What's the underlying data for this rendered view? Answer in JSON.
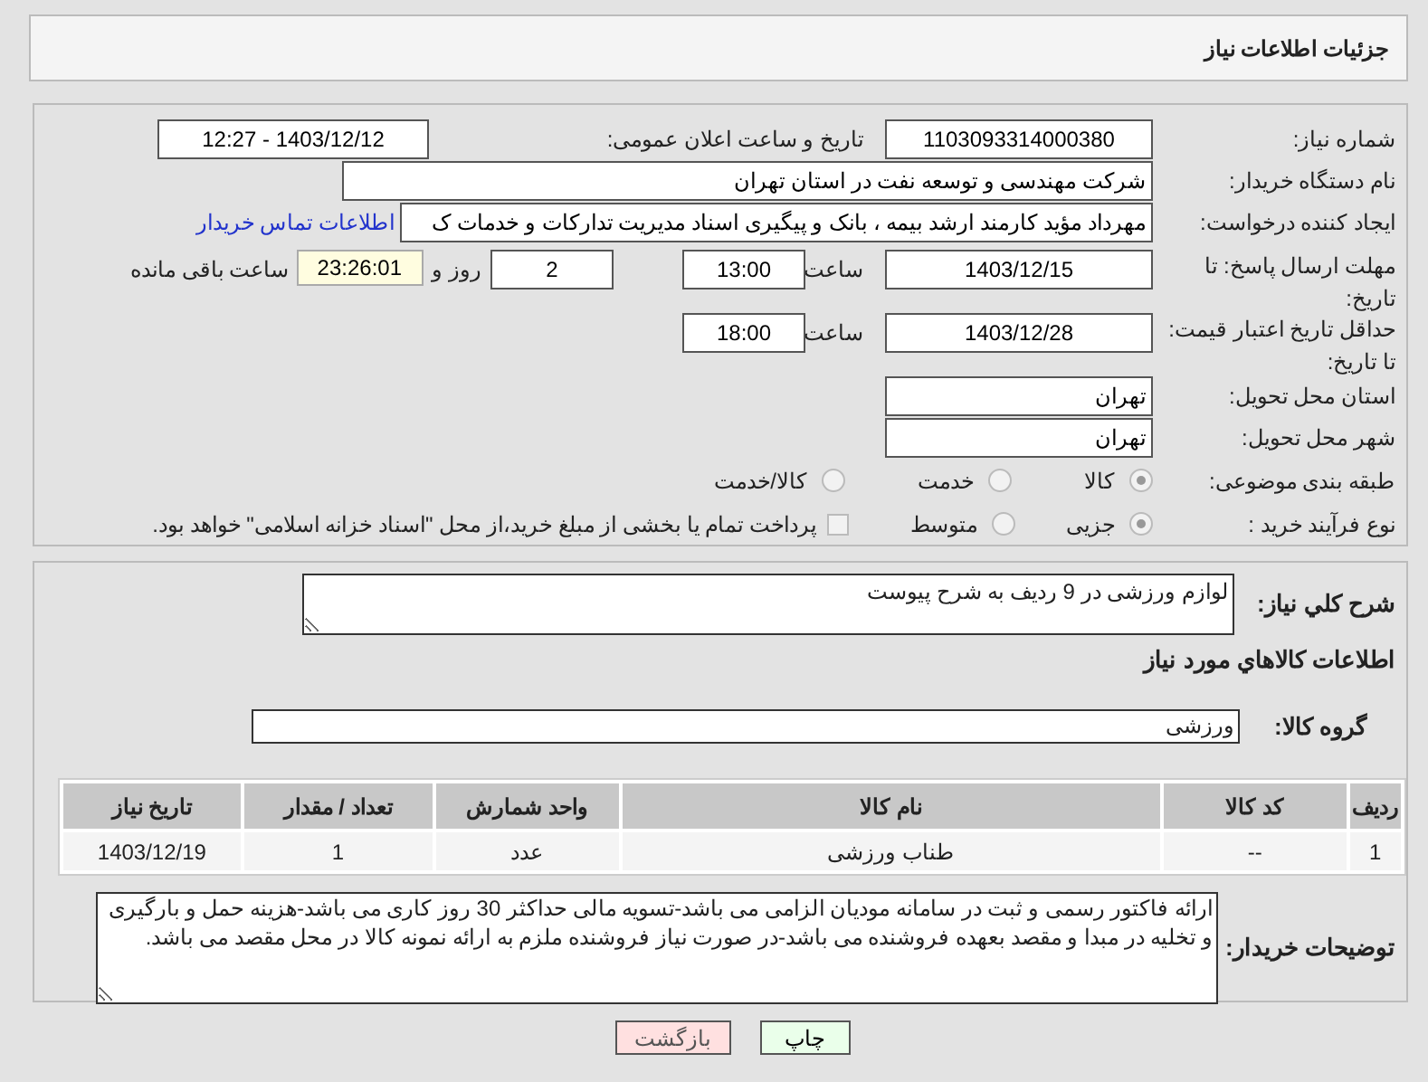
{
  "header": {
    "title": "جزئیات اطلاعات نیاز"
  },
  "need_number": {
    "label": "شماره نیاز:",
    "value": "1103093314000380"
  },
  "announce": {
    "label": "تاریخ و ساعت اعلان عمومی:",
    "value": "1403/12/12 - 12:27"
  },
  "buyer": {
    "label": "نام دستگاه خریدار:",
    "value": "شرکت مهندسی و توسعه نفت در استان تهران"
  },
  "creator": {
    "label": "ایجاد کننده درخواست:",
    "value": "مهرداد مؤید کارمند ارشد بیمه ، بانک و پیگیری اسناد مدیریت تدارکات و خدمات ک",
    "link": "اطلاعات تماس خریدار"
  },
  "deadline": {
    "label": "مهلت ارسال پاسخ: تا تاریخ:",
    "date": "1403/12/15",
    "time_label": "ساعت",
    "time": "13:00",
    "days": "2",
    "days_label": "روز و",
    "remaining": "23:26:01",
    "remaining_label": "ساعت باقی مانده"
  },
  "validity": {
    "label": "حداقل تاریخ اعتبار قیمت: تا تاریخ:",
    "date": "1403/12/28",
    "time_label": "ساعت",
    "time": "18:00"
  },
  "province": {
    "label": "استان محل تحویل:",
    "value": "تهران"
  },
  "city": {
    "label": "شهر محل تحویل:",
    "value": "تهران"
  },
  "category": {
    "label": "طبقه بندی موضوعی:",
    "options": [
      {
        "label": "کالا",
        "selected": true
      },
      {
        "label": "خدمت",
        "selected": false
      },
      {
        "label": "کالا/خدمت",
        "selected": false
      }
    ]
  },
  "process": {
    "label": "نوع فرآیند خرید :",
    "options": [
      {
        "label": "جزیی",
        "selected": true
      },
      {
        "label": "متوسط",
        "selected": false
      }
    ],
    "treasury": {
      "label": "پرداخت تمام یا بخشی از مبلغ خرید،از محل \"اسناد خزانه اسلامی\" خواهد بود.",
      "checked": false
    }
  },
  "summary": {
    "label": "شرح كلي نياز:",
    "value": "لوازم ورزشی در 9 ردیف به شرح پیوست"
  },
  "goods_heading": "اطلاعات كالاهاي مورد نياز",
  "goods_group": {
    "label": "گروه کالا:",
    "value": "ورزشی"
  },
  "table": {
    "columns": [
      "ردیف",
      "کد کالا",
      "نام کالا",
      "واحد شمارش",
      "تعداد / مقدار",
      "تاریخ نیاز"
    ],
    "rows": [
      [
        "1",
        "--",
        "طناب ورزشی",
        "عدد",
        "1",
        "1403/12/19"
      ]
    ]
  },
  "notes": {
    "label": "توضیحات خریدار:",
    "value": "ارائه فاکتور رسمی و ثبت در سامانه مودیان الزامی می باشد-تسویه مالی حداکثر 30 روز کاری می باشد-هزینه حمل و بارگیری و تخلیه در مبدا و مقصد بعهده فروشنده می باشد-در صورت نیاز فروشنده ملزم به ارائه نمونه کالا در محل مقصد می باشد."
  },
  "buttons": [
    {
      "label": "چاپ",
      "kind": "print"
    },
    {
      "label": "بازگشت",
      "kind": "back"
    }
  ]
}
